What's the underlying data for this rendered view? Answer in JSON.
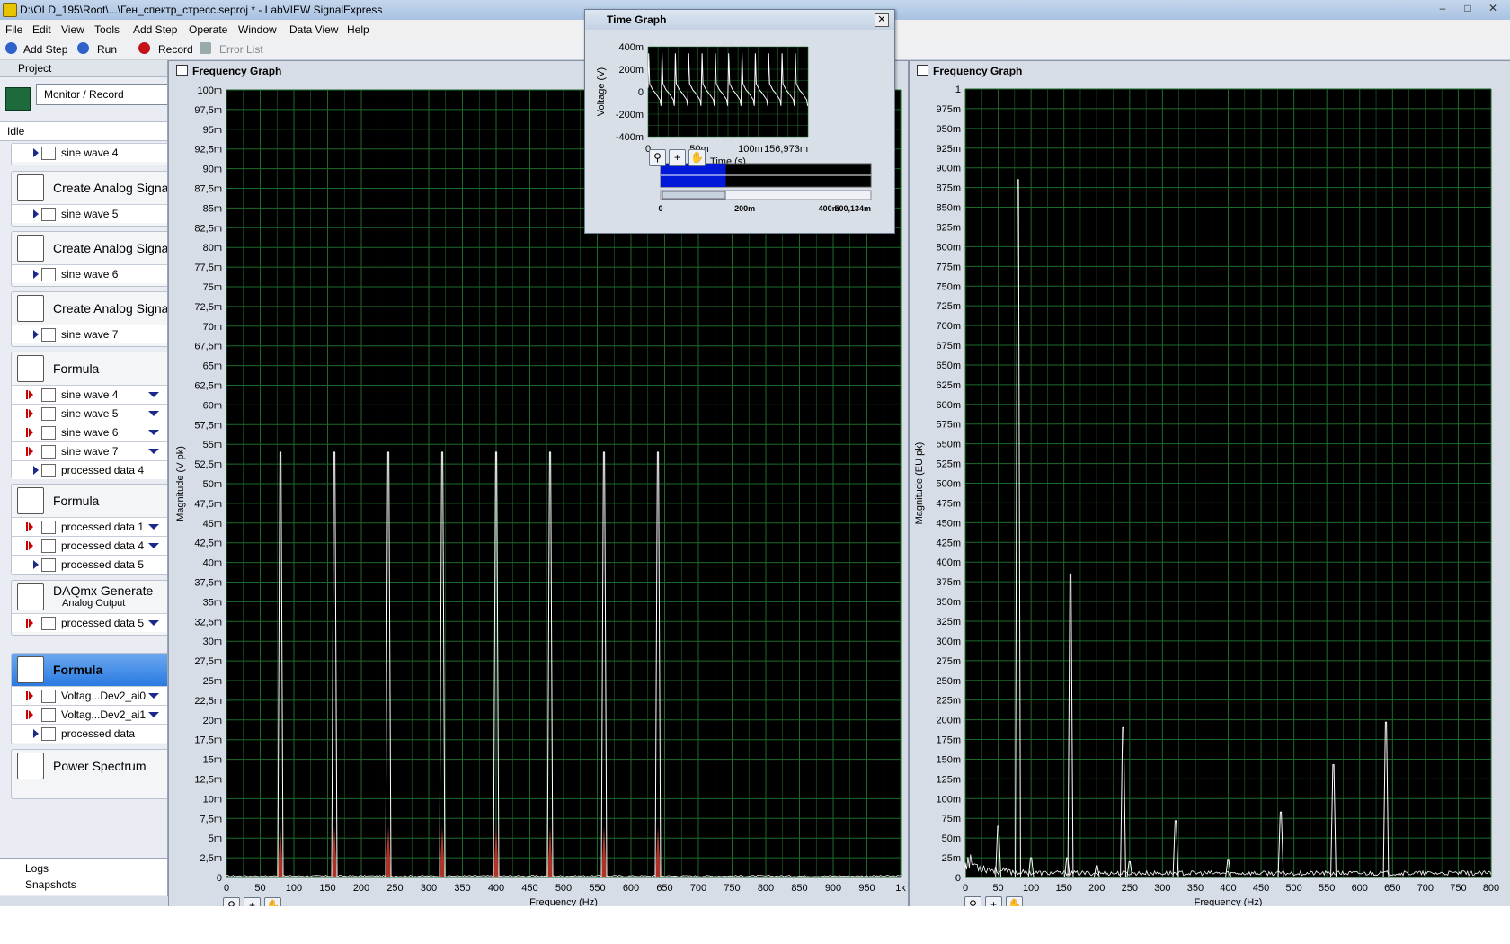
{
  "window": {
    "title": "D:\\OLD_195\\Root\\...\\Ген_спектр_стресс.seproj * - LabVIEW SignalExpress"
  },
  "menu": [
    "File",
    "Edit",
    "View",
    "Tools",
    "Add Step",
    "Operate",
    "Window",
    "Data View",
    "Help"
  ],
  "toolbar": {
    "add_step": "Add Step",
    "run": "Run",
    "record": "Record",
    "error_list": "Error List"
  },
  "project": {
    "label": "Project",
    "mode": "Monitor / Record",
    "status": "Idle"
  },
  "steps": [
    {
      "name": "",
      "channels": [
        {
          "dir": "out",
          "label": "sine wave 4",
          "dropdown": false
        }
      ]
    },
    {
      "name": "Create Analog Signal",
      "channels": [
        {
          "dir": "out",
          "label": "sine wave 5",
          "dropdown": false
        }
      ]
    },
    {
      "name": "Create Analog Signal",
      "channels": [
        {
          "dir": "out",
          "label": "sine wave 6",
          "dropdown": false
        }
      ]
    },
    {
      "name": "Create Analog Signal",
      "channels": [
        {
          "dir": "out",
          "label": "sine wave 7",
          "dropdown": false
        }
      ]
    },
    {
      "name": "Formula",
      "channels": [
        {
          "dir": "in",
          "label": "sine wave 4",
          "dropdown": true
        },
        {
          "dir": "in",
          "label": "sine wave 5",
          "dropdown": true
        },
        {
          "dir": "in",
          "label": "sine wave 6",
          "dropdown": true
        },
        {
          "dir": "in",
          "label": "sine wave 7",
          "dropdown": true
        },
        {
          "dir": "out",
          "label": "processed data 4",
          "dropdown": false
        }
      ]
    },
    {
      "name": "Formula",
      "channels": [
        {
          "dir": "in",
          "label": "processed data 1",
          "dropdown": true
        },
        {
          "dir": "in",
          "label": "processed data 4",
          "dropdown": true
        },
        {
          "dir": "out",
          "label": "processed data 5",
          "dropdown": false
        }
      ]
    },
    {
      "name": "DAQmx Generate",
      "sub": "Analog Output",
      "channels": [
        {
          "dir": "in",
          "label": "processed data 5",
          "dropdown": true
        }
      ]
    },
    {
      "name": "Formula",
      "selected": true,
      "channels": [
        {
          "dir": "in",
          "label": "Voltag...Dev2_ai0",
          "dropdown": true
        },
        {
          "dir": "in",
          "label": "Voltag...Dev2_ai1",
          "dropdown": true
        },
        {
          "dir": "out",
          "label": "processed data",
          "dropdown": false
        }
      ]
    },
    {
      "name": "Power Spectrum",
      "channels": []
    }
  ],
  "tree": {
    "logs": "Logs",
    "snapshots": "Snapshots"
  },
  "colors": {
    "plot_bg": "#000000",
    "grid": "#1d6b2a",
    "trace": "#ffffff",
    "harmonic_base": "#c0392b",
    "selection": "#0018d8"
  },
  "time_graph": {
    "title": "Time Graph",
    "xlabel": "Time (s)",
    "ylabel": "Voltage (V)",
    "yticks": [
      "400m",
      "200m",
      "0",
      "-200m",
      "-400m"
    ],
    "xticks": [
      "0",
      "50m",
      "100m",
      "156,973m"
    ],
    "overview_ticks": [
      "0",
      "200m",
      "400m",
      "500,134m"
    ]
  },
  "chart_data": [
    {
      "type": "line",
      "title": "Frequency Graph",
      "xlabel": "Frequency (Hz)",
      "ylabel": "Magnitude (V pk)",
      "xlim": [
        0,
        1000
      ],
      "ylim": [
        0,
        0.1
      ],
      "grid": true,
      "yticks": [
        "100m",
        "97,5m",
        "95m",
        "92,5m",
        "90m",
        "87,5m",
        "85m",
        "82,5m",
        "80m",
        "77,5m",
        "75m",
        "72,5m",
        "70m",
        "67,5m",
        "65m",
        "62,5m",
        "60m",
        "57,5m",
        "55m",
        "52,5m",
        "50m",
        "47,5m",
        "45m",
        "42,5m",
        "40m",
        "37,5m",
        "35m",
        "32,5m",
        "30m",
        "27,5m",
        "25m",
        "22,5m",
        "20m",
        "17,5m",
        "15m",
        "12,5m",
        "10m",
        "7,5m",
        "5m",
        "2,5m",
        "0"
      ],
      "xticks": [
        "0",
        "50",
        "100",
        "150",
        "200",
        "250",
        "300",
        "350",
        "400",
        "450",
        "500",
        "550",
        "600",
        "650",
        "700",
        "750",
        "800",
        "850",
        "900",
        "950",
        "1k"
      ],
      "peaks": [
        {
          "x": 80,
          "y": 0.054
        },
        {
          "x": 160,
          "y": 0.054
        },
        {
          "x": 240,
          "y": 0.054
        },
        {
          "x": 320,
          "y": 0.054
        },
        {
          "x": 400,
          "y": 0.054
        },
        {
          "x": 480,
          "y": 0.054
        },
        {
          "x": 560,
          "y": 0.054
        },
        {
          "x": 640,
          "y": 0.054
        }
      ]
    },
    {
      "type": "line",
      "title": "Frequency Graph",
      "xlabel": "Frequency (Hz)",
      "ylabel": "Magnitude (EU pk)",
      "xlim": [
        0,
        800
      ],
      "ylim": [
        0,
        1
      ],
      "grid": true,
      "yticks": [
        "1",
        "975m",
        "950m",
        "925m",
        "900m",
        "875m",
        "850m",
        "825m",
        "800m",
        "775m",
        "750m",
        "725m",
        "700m",
        "675m",
        "650m",
        "625m",
        "600m",
        "575m",
        "550m",
        "525m",
        "500m",
        "475m",
        "450m",
        "425m",
        "400m",
        "375m",
        "350m",
        "325m",
        "300m",
        "275m",
        "250m",
        "225m",
        "200m",
        "175m",
        "150m",
        "125m",
        "100m",
        "75m",
        "50m",
        "25m",
        "0"
      ],
      "xticks": [
        "0",
        "50",
        "100",
        "150",
        "200",
        "250",
        "300",
        "350",
        "400",
        "450",
        "500",
        "550",
        "600",
        "650",
        "700",
        "750",
        "800"
      ],
      "peaks": [
        {
          "x": 50,
          "y": 0.065
        },
        {
          "x": 80,
          "y": 0.885
        },
        {
          "x": 100,
          "y": 0.025
        },
        {
          "x": 155,
          "y": 0.025
        },
        {
          "x": 160,
          "y": 0.385
        },
        {
          "x": 200,
          "y": 0.015
        },
        {
          "x": 240,
          "y": 0.19
        },
        {
          "x": 250,
          "y": 0.02
        },
        {
          "x": 320,
          "y": 0.072
        },
        {
          "x": 400,
          "y": 0.022
        },
        {
          "x": 480,
          "y": 0.083
        },
        {
          "x": 560,
          "y": 0.143
        },
        {
          "x": 640,
          "y": 0.197
        }
      ]
    }
  ]
}
